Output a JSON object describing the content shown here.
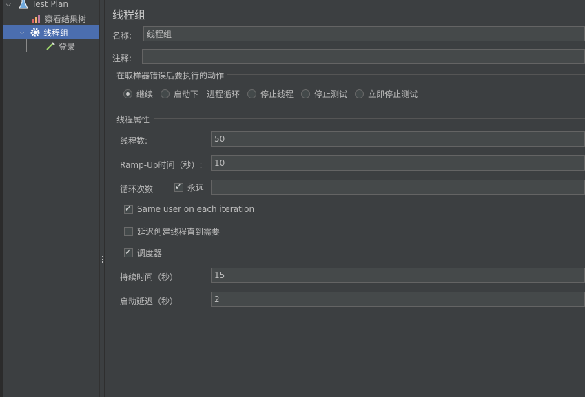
{
  "tree": {
    "items": [
      {
        "label": "Test Plan",
        "icon": "flask-icon"
      },
      {
        "label": "察看结果树",
        "icon": "chart-icon"
      },
      {
        "label": "线程组",
        "icon": "gear-icon",
        "selected": true
      },
      {
        "label": "登录",
        "icon": "pipette-icon"
      }
    ]
  },
  "panel": {
    "title": "线程组",
    "name_label": "名称:",
    "name_value": "线程组",
    "comment_label": "注释:",
    "comment_value": "",
    "sampler_error": {
      "title": "在取样器错误后要执行的动作",
      "options": [
        "继续",
        "启动下一进程循环",
        "停止线程",
        "停止测试",
        "立即停止测试"
      ],
      "selected_index": 0
    },
    "thread_props": {
      "title": "线程属性",
      "threads_label": "线程数:",
      "threads_value": "50",
      "rampup_label": "Ramp-Up时间（秒）:",
      "rampup_value": "10",
      "loop_label": "循环次数",
      "forever_label": "永远",
      "forever_checked": true,
      "loop_value": "",
      "same_user_label": "Same user on each iteration",
      "same_user_checked": true,
      "delay_label": "延迟创建线程直到需要",
      "delay_checked": false,
      "scheduler_label": "调度器",
      "scheduler_checked": true,
      "duration_label": "持续时间（秒）",
      "duration_value": "15",
      "startup_label": "启动延迟（秒）",
      "startup_value": "2"
    }
  }
}
